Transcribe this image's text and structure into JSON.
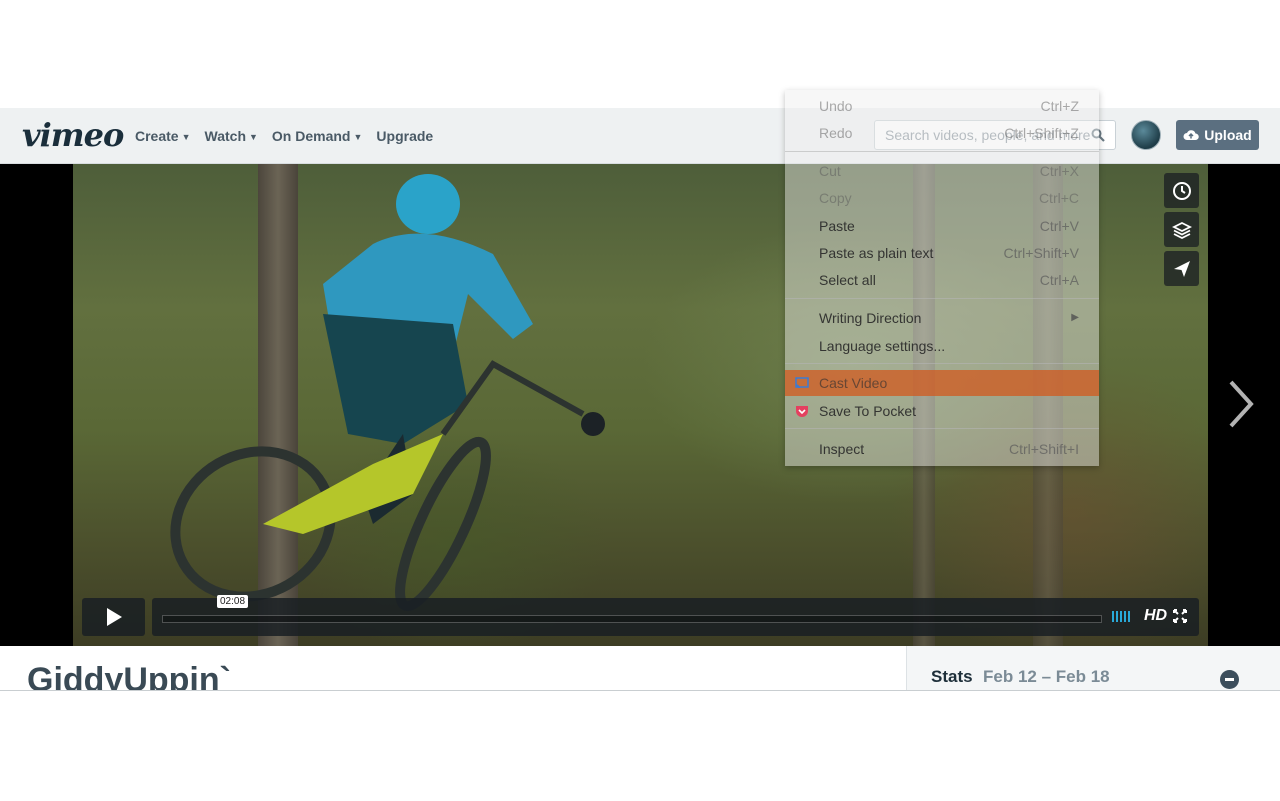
{
  "header": {
    "logo": "vimeo",
    "nav": [
      {
        "label": "Create",
        "dropdown": true
      },
      {
        "label": "Watch",
        "dropdown": true
      },
      {
        "label": "On Demand",
        "dropdown": true
      },
      {
        "label": "Upgrade",
        "dropdown": false
      }
    ],
    "search_placeholder": "Search videos, people, and more",
    "upload_label": "Upload"
  },
  "player": {
    "hover_time": "02:08",
    "quality": "HD",
    "side_actions": [
      "clock-icon",
      "layers-icon",
      "send-icon"
    ]
  },
  "context_menu": {
    "items": [
      {
        "label": "Undo",
        "shortcut": "Ctrl+Z",
        "enabled": false
      },
      {
        "label": "Redo",
        "shortcut": "Ctrl+Shift+Z",
        "enabled": false
      },
      {
        "label": "Cut",
        "shortcut": "Ctrl+X",
        "enabled": false
      },
      {
        "label": "Copy",
        "shortcut": "Ctrl+C",
        "enabled": false
      },
      {
        "label": "Paste",
        "shortcut": "Ctrl+V",
        "enabled": true
      },
      {
        "label": "Paste as plain text",
        "shortcut": "Ctrl+Shift+V",
        "enabled": true
      },
      {
        "label": "Select all",
        "shortcut": "Ctrl+A",
        "enabled": true
      },
      {
        "label": "Writing Direction",
        "shortcut": "",
        "enabled": true
      },
      {
        "label": "Language settings...",
        "shortcut": "",
        "enabled": true
      },
      {
        "label": "Cast Video",
        "shortcut": "",
        "enabled": true
      },
      {
        "label": "Save To Pocket",
        "shortcut": "",
        "enabled": true
      },
      {
        "label": "Inspect",
        "shortcut": "Ctrl+Shift+I",
        "enabled": true
      }
    ]
  },
  "video": {
    "title": "GiddyUppin`"
  },
  "stats": {
    "label": "Stats",
    "range": "Feb 12 – Feb 18"
  },
  "colors": {
    "header_bg": "#eef1f2",
    "upload_bg": "#5b6f80",
    "volume_accent": "#29a9d8",
    "menu_highlight": "#d25a1e"
  }
}
